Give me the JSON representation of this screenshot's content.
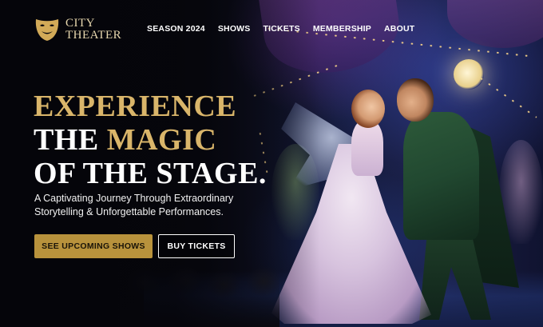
{
  "brand": {
    "line1": "CITY",
    "line2": "THEATER",
    "logo_icon": "theater-mask-icon",
    "color": "#e8d8ae"
  },
  "nav": {
    "items": [
      {
        "label": "SEASON 2024"
      },
      {
        "label": "SHOWS"
      },
      {
        "label": "TICKETS"
      },
      {
        "label": "MEMBERSHIP"
      },
      {
        "label": "ABOUT"
      }
    ]
  },
  "hero": {
    "title_line1": "EXPERIENCE",
    "title_line2_a": "THE ",
    "title_line2_b": "MAGIC",
    "title_line3": "OF THE STAGE.",
    "subtitle_line1": "A Captivating Journey Through Extraordinary",
    "subtitle_line2": "Storytelling & Unforgettable Performances.",
    "primary_cta": "SEE UPCOMING SHOWS",
    "secondary_cta": "BUY TICKETS"
  },
  "colors": {
    "accent_gold": "#d9b56a",
    "button_gold": "#b8923c",
    "background": "#07070d"
  }
}
